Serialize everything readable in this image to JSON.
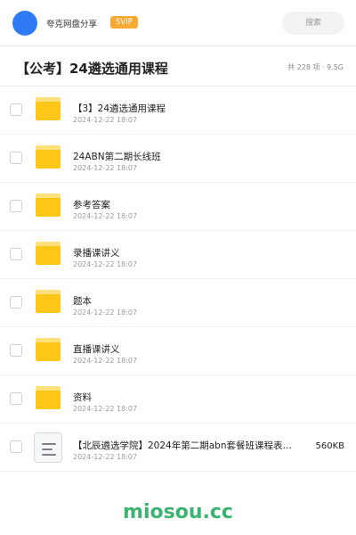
{
  "header": {
    "username": "夸克网盘分享",
    "badge": "SVIP",
    "search_label": "搜索",
    "avatar_color": "#2f7bf6",
    "badge_color": "#f7a934"
  },
  "folder": {
    "title": "【公考】24遴选通用课程",
    "meta": "共 228 项 · 9.5G"
  },
  "items": [
    {
      "name": "【3】24遴选通用课程",
      "date": "2024-12-22 18:07",
      "type": "folder"
    },
    {
      "name": "24ABN第二期长线班",
      "date": "2024-12-22 18:07",
      "type": "folder"
    },
    {
      "name": "参考答案",
      "date": "2024-12-22 18:07",
      "type": "folder"
    },
    {
      "name": "录播课讲义",
      "date": "2024-12-22 18:07",
      "type": "folder"
    },
    {
      "name": "题本",
      "date": "2024-12-22 18:07",
      "type": "folder"
    },
    {
      "name": "直播课讲义",
      "date": "2024-12-22 18:07",
      "type": "folder"
    },
    {
      "name": "资料",
      "date": "2024-12-22 18:07",
      "type": "folder"
    },
    {
      "name": "【北辰遴选学院】2024年第二期abn套餐班课程表…",
      "date": "2024-12-22 18:07",
      "type": "document",
      "size": "560KB"
    }
  ],
  "watermark": "miosou.cc",
  "colors": {
    "folder_yellow": "#ffc61a",
    "watermark_green": "#3cb371"
  }
}
